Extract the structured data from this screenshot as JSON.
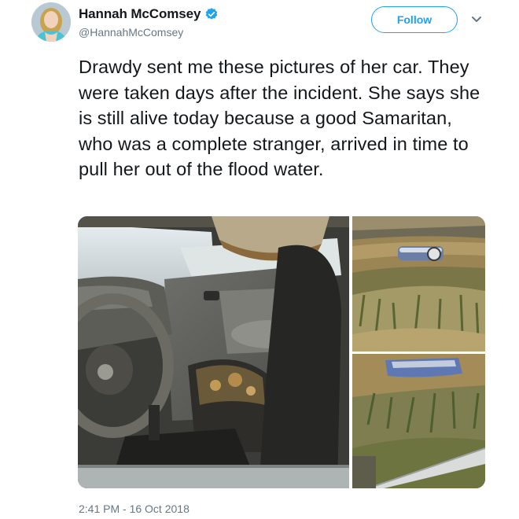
{
  "tweet": {
    "author": {
      "display_name": "Hannah McComsey",
      "handle": "@HannahMcComsey",
      "verified": true,
      "avatar_icon": "user-avatar-photo"
    },
    "follow_label": "Follow",
    "more_icon": "chevron-down-icon",
    "text": "Drawdy sent me these pictures of her car. They were taken days after the incident. She says she is still alive today because a good Samaritan, who was a complete stranger, arrived in time to pull her out of the flood water.",
    "photos": [
      {
        "subject": "flood-damaged car interior"
      },
      {
        "subject": "overturned car in flood water"
      },
      {
        "subject": "submerged car near muddy bank"
      }
    ],
    "timestamp": "2:41 PM - 16 Oct 2018"
  },
  "colors": {
    "accent": "#1da1f2",
    "text": "#14171a",
    "secondary_text": "#657786"
  }
}
